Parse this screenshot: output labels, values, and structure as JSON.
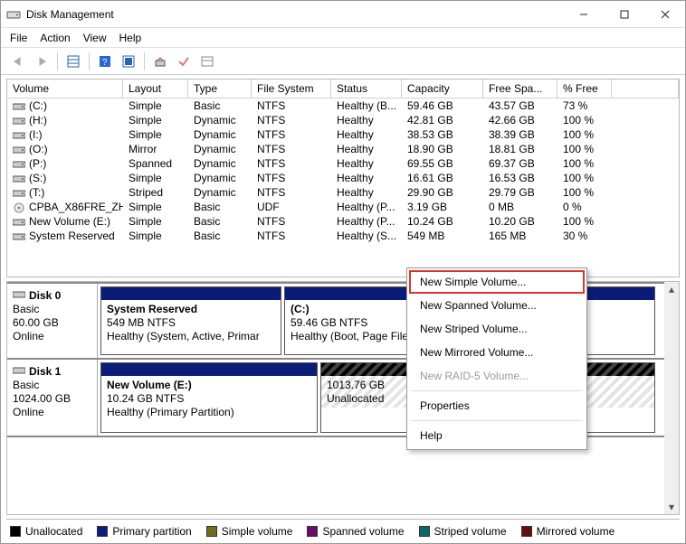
{
  "window": {
    "title": "Disk Management"
  },
  "menu": {
    "items": [
      "File",
      "Action",
      "View",
      "Help"
    ]
  },
  "volumes": {
    "headers": [
      "Volume",
      "Layout",
      "Type",
      "File System",
      "Status",
      "Capacity",
      "Free Spa...",
      "% Free"
    ],
    "rows": [
      {
        "icon": "vol",
        "name": "(C:)",
        "layout": "Simple",
        "type": "Basic",
        "fs": "NTFS",
        "status": "Healthy (B...",
        "cap": "59.46 GB",
        "free": "43.57 GB",
        "pct": "73 %"
      },
      {
        "icon": "vol",
        "name": "(H:)",
        "layout": "Simple",
        "type": "Dynamic",
        "fs": "NTFS",
        "status": "Healthy",
        "cap": "42.81 GB",
        "free": "42.66 GB",
        "pct": "100 %"
      },
      {
        "icon": "vol",
        "name": "(I:)",
        "layout": "Simple",
        "type": "Dynamic",
        "fs": "NTFS",
        "status": "Healthy",
        "cap": "38.53 GB",
        "free": "38.39 GB",
        "pct": "100 %"
      },
      {
        "icon": "vol",
        "name": "(O:)",
        "layout": "Mirror",
        "type": "Dynamic",
        "fs": "NTFS",
        "status": "Healthy",
        "cap": "18.90 GB",
        "free": "18.81 GB",
        "pct": "100 %"
      },
      {
        "icon": "vol",
        "name": "(P:)",
        "layout": "Spanned",
        "type": "Dynamic",
        "fs": "NTFS",
        "status": "Healthy",
        "cap": "69.55 GB",
        "free": "69.37 GB",
        "pct": "100 %"
      },
      {
        "icon": "vol",
        "name": "(S:)",
        "layout": "Simple",
        "type": "Dynamic",
        "fs": "NTFS",
        "status": "Healthy",
        "cap": "16.61 GB",
        "free": "16.53 GB",
        "pct": "100 %"
      },
      {
        "icon": "vol",
        "name": "(T:)",
        "layout": "Striped",
        "type": "Dynamic",
        "fs": "NTFS",
        "status": "Healthy",
        "cap": "29.90 GB",
        "free": "29.79 GB",
        "pct": "100 %"
      },
      {
        "icon": "cd",
        "name": "CPBA_X86FRE_ZH...",
        "layout": "Simple",
        "type": "Basic",
        "fs": "UDF",
        "status": "Healthy (P...",
        "cap": "3.19 GB",
        "free": "0 MB",
        "pct": "0 %"
      },
      {
        "icon": "vol",
        "name": "New Volume (E:)",
        "layout": "Simple",
        "type": "Basic",
        "fs": "NTFS",
        "status": "Healthy (P...",
        "cap": "10.24 GB",
        "free": "10.20 GB",
        "pct": "100 %"
      },
      {
        "icon": "vol",
        "name": "System Reserved",
        "layout": "Simple",
        "type": "Basic",
        "fs": "NTFS",
        "status": "Healthy (S...",
        "cap": "549 MB",
        "free": "165 MB",
        "pct": "30 %"
      }
    ]
  },
  "disks": [
    {
      "name": "Disk 0",
      "type": "Basic",
      "size": "60.00 GB",
      "state": "Online",
      "parts": [
        {
          "title": "System Reserved",
          "line1": "549 MB NTFS",
          "line2": "Healthy (System, Active, Primar",
          "wpx": 200,
          "kind": "primary"
        },
        {
          "title": "(C:)",
          "line1": "59.46 GB NTFS",
          "line2": "Healthy (Boot, Page File,",
          "wpx": 410,
          "kind": "primary"
        }
      ]
    },
    {
      "name": "Disk 1",
      "type": "Basic",
      "size": "1024.00 GB",
      "state": "Online",
      "parts": [
        {
          "title": "New Volume  (E:)",
          "line1": "10.24 GB NTFS",
          "line2": "Healthy (Primary Partition)",
          "wpx": 240,
          "kind": "primary"
        },
        {
          "title": "",
          "line1": "1013.76 GB",
          "line2": "Unallocated",
          "wpx": 370,
          "kind": "unalloc"
        }
      ]
    }
  ],
  "legend": [
    {
      "color": "#000000",
      "label": "Unallocated"
    },
    {
      "color": "#0a1c7a",
      "label": "Primary partition"
    },
    {
      "color": "#6e6e18",
      "label": "Simple volume"
    },
    {
      "color": "#6a0c6a",
      "label": "Spanned volume"
    },
    {
      "color": "#0a6a6a",
      "label": "Striped volume"
    },
    {
      "color": "#6a0c0c",
      "label": "Mirrored volume"
    }
  ],
  "context": {
    "items": [
      {
        "label": "New Simple Volume...",
        "enabled": true,
        "highlight": true
      },
      {
        "label": "New Spanned Volume...",
        "enabled": true
      },
      {
        "label": "New Striped Volume...",
        "enabled": true
      },
      {
        "label": "New Mirrored Volume...",
        "enabled": true
      },
      {
        "label": "New RAID-5 Volume...",
        "enabled": false
      },
      {
        "sep": true
      },
      {
        "label": "Properties",
        "enabled": true
      },
      {
        "sep": true
      },
      {
        "label": "Help",
        "enabled": true
      }
    ]
  }
}
